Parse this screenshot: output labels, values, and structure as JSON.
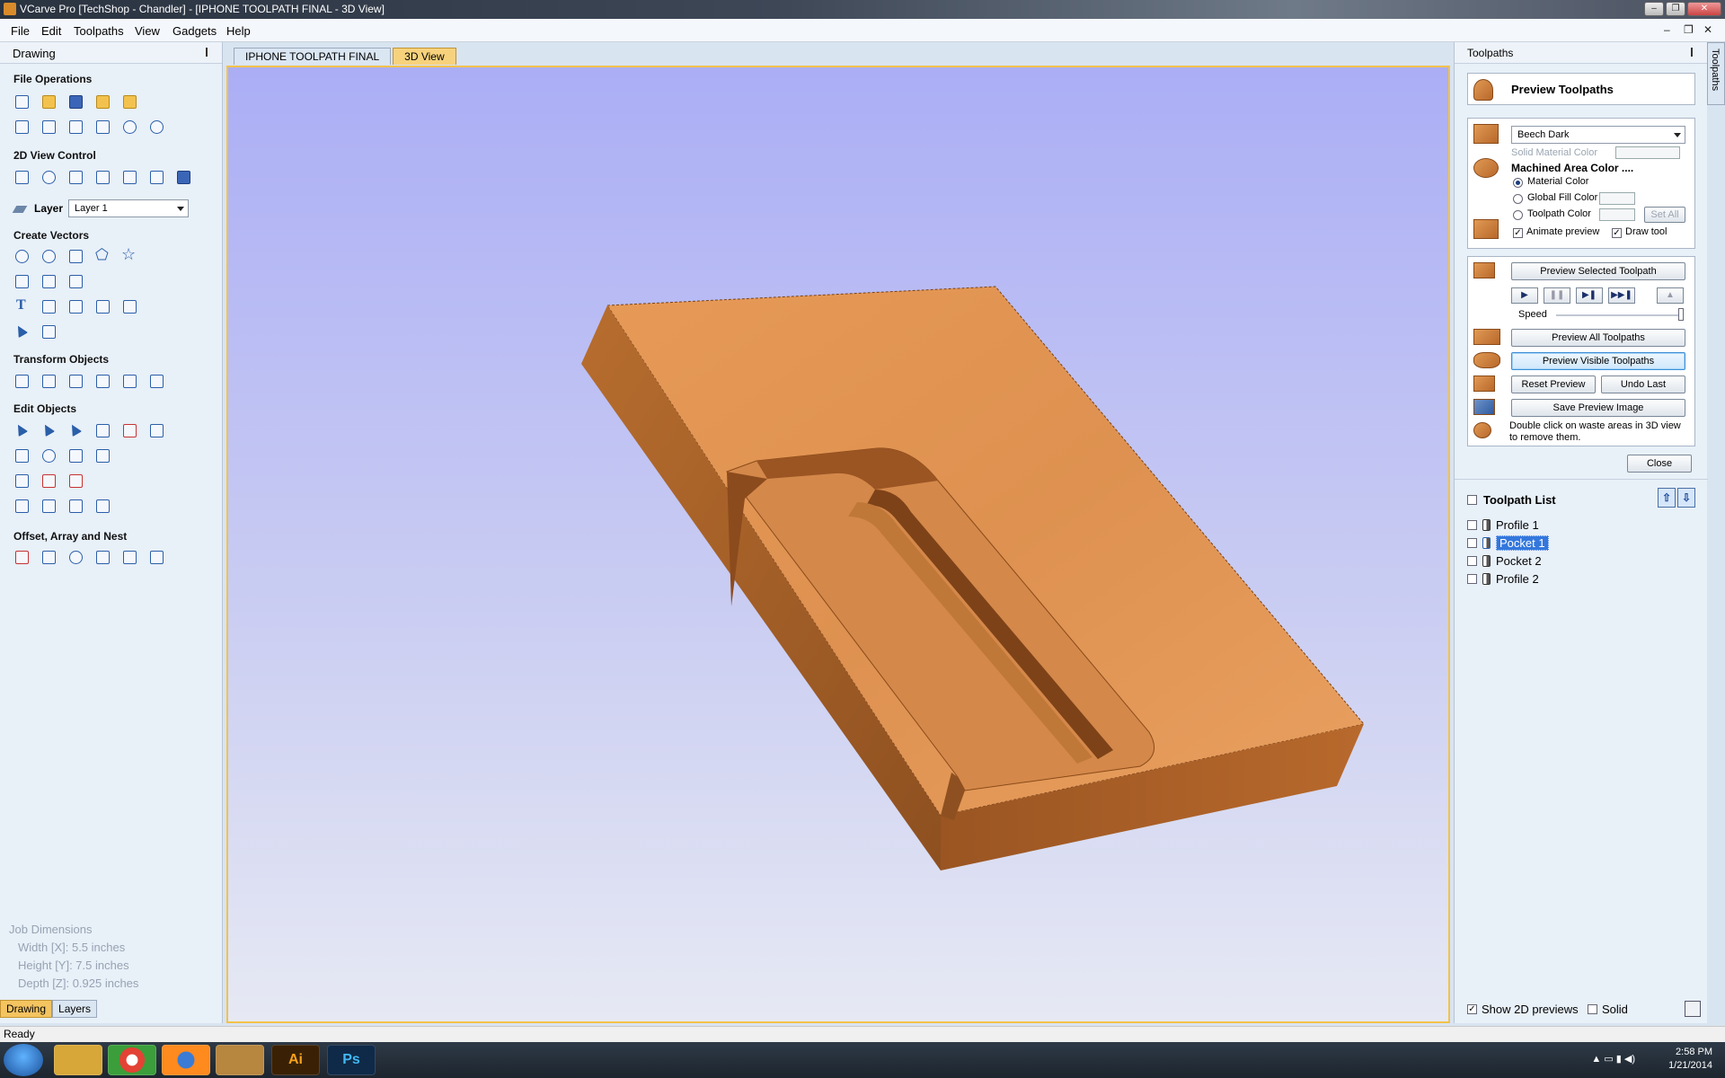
{
  "window": {
    "title": "VCarve Pro [TechShop - Chandler] - [IPHONE TOOLPATH FINAL - 3D View]",
    "buttons": [
      "–",
      "❐",
      "✕"
    ]
  },
  "menu": {
    "items": [
      "File",
      "Edit",
      "Toolpaths",
      "View",
      "Gadgets",
      "Help"
    ],
    "mdi_buttons": [
      "–",
      "❐",
      "✕"
    ]
  },
  "left_panel": {
    "title": "Drawing",
    "sections": {
      "file_operations": "File Operations",
      "view_control": "2D View Control",
      "create_vectors": "Create Vectors",
      "transform_objects": "Transform Objects",
      "edit_objects": "Edit Objects",
      "offset_array_nest": "Offset, Array and Nest"
    },
    "layer_label": "Layer",
    "layer_value": "Layer 1",
    "job_dimensions": {
      "title": "Job Dimensions",
      "width": "Width  [X]: 5.5 inches",
      "height": "Height [Y]: 7.5 inches",
      "depth": "Depth  [Z]: 0.925 inches"
    },
    "bottom_tabs": [
      "Drawing",
      "Layers"
    ]
  },
  "doc_tabs": [
    "IPHONE TOOLPATH FINAL",
    "3D View"
  ],
  "right_panel": {
    "title": "Toolpaths",
    "side_tab": "Toolpaths",
    "preview_header": "Preview Toolpaths",
    "material": "Beech Dark",
    "solid_material_color": "Solid Material Color",
    "machined_area_color": "Machined Area Color ....",
    "radio_material": "Material Color",
    "radio_global": "Global Fill Color",
    "radio_toolpath": "Toolpath Color",
    "set_all": "Set All",
    "animate_preview": "Animate preview",
    "draw_tool": "Draw tool",
    "preview_selected": "Preview Selected Toolpath",
    "speed": "Speed",
    "preview_all": "Preview All Toolpaths",
    "preview_visible": "Preview Visible Toolpaths",
    "reset_preview": "Reset Preview",
    "undo_last": "Undo Last",
    "save_preview_image": "Save Preview Image",
    "hint": "Double click on waste areas in 3D view to remove them.",
    "close": "Close",
    "toolpath_list_title": "Toolpath List",
    "toolpaths": [
      "Profile 1",
      "Pocket 1",
      "Pocket 2",
      "Profile 2"
    ],
    "selected_toolpath": "Pocket 1",
    "show_2d_previews": "Show 2D previews",
    "solid": "Solid"
  },
  "status": {
    "text": "Ready"
  },
  "taskbar": {
    "apps": [
      "Ai",
      "Ps"
    ],
    "time": "2:58 PM",
    "date": "1/21/2014"
  },
  "colors": {
    "accent": "#f2c24a",
    "selection": "#3377dd",
    "wood_top": "#dc8f4a",
    "wood_side": "#a8612a"
  }
}
